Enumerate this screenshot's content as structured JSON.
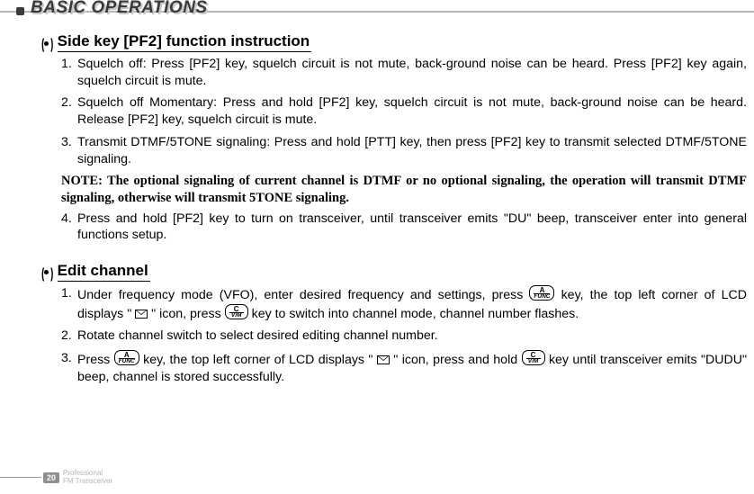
{
  "header": {
    "title": "BASIC OPERATIONS"
  },
  "section1": {
    "title": "Side key [PF2] function instruction",
    "items": [
      "Squelch off: Press [PF2] key, squelch circuit is not mute, back-ground noise can be heard. Press [PF2] key again, squelch circuit is mute.",
      "Squelch off Momentary: Press and hold [PF2] key, squelch circuit is not mute, back-ground noise can be heard. Release [PF2] key, squelch circuit is mute.",
      "Transmit DTMF/5TONE signaling: Press and hold [PTT] key, then press [PF2] key to transmit selected DTMF/5TONE signaling."
    ],
    "note": "NOTE: The optional signaling of current channel is DTMF or no optional signaling, the operation will transmit DTMF signaling, otherwise will transmit 5TONE signaling.",
    "item4": "Press and hold [PF2] key to turn on transceiver, until transceiver emits \"DU\" beep, transceiver enter into general functions setup."
  },
  "section2": {
    "title": "Edit channel",
    "i1a": "Under frequency mode (VFO), enter desired frequency and settings, press ",
    "i1b": " key, the top left corner of LCD displays \" ",
    "i1c": " \" icon, press ",
    "i1d": " key to switch into channel mode, channel number flashes.",
    "i2": "Rotate channel switch to select desired editing channel number.",
    "i3a": "Press ",
    "i3b": " key, the top left corner of LCD displays \" ",
    "i3c": " \" icon, press and hold ",
    "i3d": " key until transceiver emits \"DUDU\" beep, channel is stored successfully."
  },
  "keys": {
    "a_sup": "A",
    "a_sub": "FUNC",
    "c_sup": "C",
    "c_sub": "V/M"
  },
  "footer": {
    "page": "20",
    "line1": "Professional",
    "line2": "FM Transceiver"
  }
}
